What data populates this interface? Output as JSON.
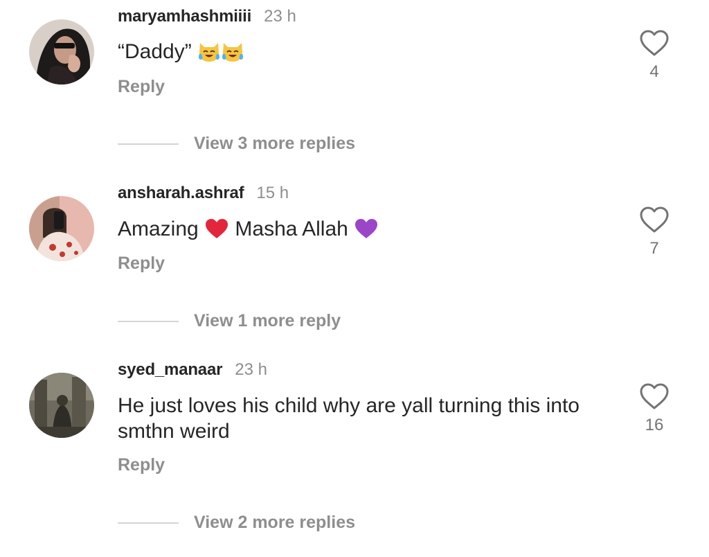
{
  "comments": [
    {
      "username": "maryamhashmiiii",
      "time": "23 h",
      "text_before": "“Daddy”",
      "emojis": [
        "crying-laughing-cat-emoji",
        "crying-laughing-cat-emoji"
      ],
      "reply_label": "Reply",
      "likes": "4",
      "more_replies": "View 3 more replies"
    },
    {
      "username": "ansharah.ashraf",
      "time": "15 h",
      "text_part1": "Amazing",
      "text_part2": "Masha Allah",
      "emojis": [
        "red-heart-emoji",
        "purple-heart-emoji"
      ],
      "reply_label": "Reply",
      "likes": "7",
      "more_replies": "View 1 more reply"
    },
    {
      "username": "syed_manaar",
      "time": "23 h",
      "text": "He just loves his child why are yall turning this into smthn weird",
      "reply_label": "Reply",
      "likes": "16",
      "more_replies": "View 2 more replies"
    }
  ],
  "colors": {
    "text": "#262626",
    "muted": "#8e8e8e",
    "count": "#737373",
    "divider": "#d4d4d4",
    "red_heart": "#e2263b",
    "purple_heart": "#9b46c9"
  }
}
